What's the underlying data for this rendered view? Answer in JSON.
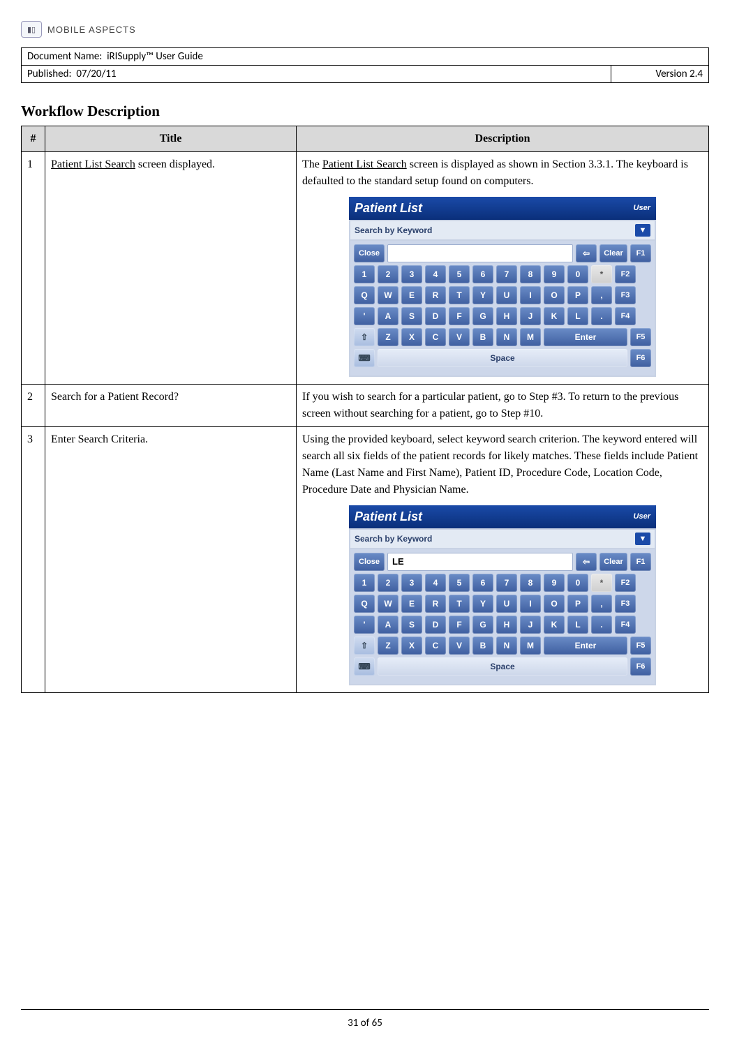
{
  "logo": {
    "brand": "MOBILE ASPECTS"
  },
  "meta": {
    "doc_label": "Document Name:",
    "doc_name": "iRISupply™ User Guide",
    "pub_label": "Published:",
    "pub_date": "07/20/11",
    "version": "Version 2.4"
  },
  "section_title": "Workflow Description",
  "table": {
    "headers": {
      "num": "#",
      "title": "Title",
      "desc": "Description"
    },
    "rows": [
      {
        "num": "1",
        "title_linked": "Patient List Search",
        "title_rest": " screen displayed.",
        "desc_pre": "The ",
        "desc_linked": "Patient List Search",
        "desc_post": " screen is displayed as shown in Section 3.3.1.  The keyboard is defaulted to the standard setup found on computers.",
        "shot_input": ""
      },
      {
        "num": "2",
        "title": "Search for a Patient Record?",
        "desc": "If you wish to search for a particular patient, go to Step #3.  To return to the previous screen without searching for a patient, go to Step #10."
      },
      {
        "num": "3",
        "title": "Enter Search Criteria.",
        "desc": "Using the provided keyboard, select keyword search criterion.  The keyword entered will search all six fields of the patient records for likely matches.  These fields include Patient Name (Last Name and First Name), Patient ID, Procedure Code, Location Code, Procedure Date and Physician Name.",
        "shot_input": "LE"
      }
    ]
  },
  "shot": {
    "title": "Patient List",
    "user": "User",
    "subtitle": "Search by Keyword",
    "close": "Close",
    "clear": "Clear",
    "back_arrow": "⇦",
    "rows": {
      "r1": [
        "1",
        "2",
        "3",
        "4",
        "5",
        "6",
        "7",
        "8",
        "9",
        "0",
        "*"
      ],
      "r2": [
        "Q",
        "W",
        "E",
        "R",
        "T",
        "Y",
        "U",
        "I",
        "O",
        "P",
        ","
      ],
      "r3": [
        "'",
        "A",
        "S",
        "D",
        "F",
        "G",
        "H",
        "J",
        "K",
        "L",
        "."
      ],
      "r4_lead": "⇧",
      "r4": [
        "Z",
        "X",
        "C",
        "V",
        "B",
        "N",
        "M"
      ],
      "enter": "Enter",
      "space": "Space",
      "kbicon": "⌨",
      "f": [
        "F1",
        "F2",
        "F3",
        "F4",
        "F5",
        "F6"
      ]
    }
  },
  "footer": {
    "page": "31 of 65"
  }
}
